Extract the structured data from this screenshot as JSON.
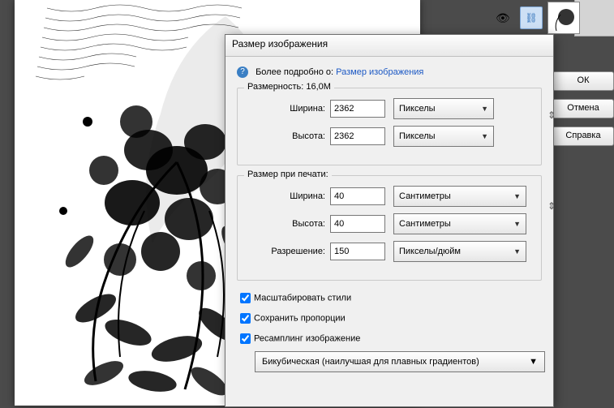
{
  "dialog": {
    "title": "Размер изображения",
    "info_text": "Более подробно о:",
    "info_link": "Размер изображения"
  },
  "dimensions": {
    "label": "Размерность:",
    "size": "16,0M",
    "width_label": "Ширина:",
    "width_value": "2362",
    "width_unit": "Пикселы",
    "height_label": "Высота:",
    "height_value": "2362",
    "height_unit": "Пикселы"
  },
  "print": {
    "label": "Размер при печати:",
    "width_label": "Ширина:",
    "width_value": "40",
    "width_unit": "Сантиметры",
    "height_label": "Высота:",
    "height_value": "40",
    "height_unit": "Сантиметры",
    "res_label": "Разрешение:",
    "res_value": "150",
    "res_unit": "Пикселы/дюйм"
  },
  "options": {
    "scale_styles": "Масштабировать стили",
    "constrain": "Сохранить пропорции",
    "resample": "Ресамплинг изображение",
    "method": "Бикубическая (наилучшая для плавных градиентов)"
  },
  "buttons": {
    "ok": "ОК",
    "cancel": "Отмена",
    "help": "Справка"
  }
}
